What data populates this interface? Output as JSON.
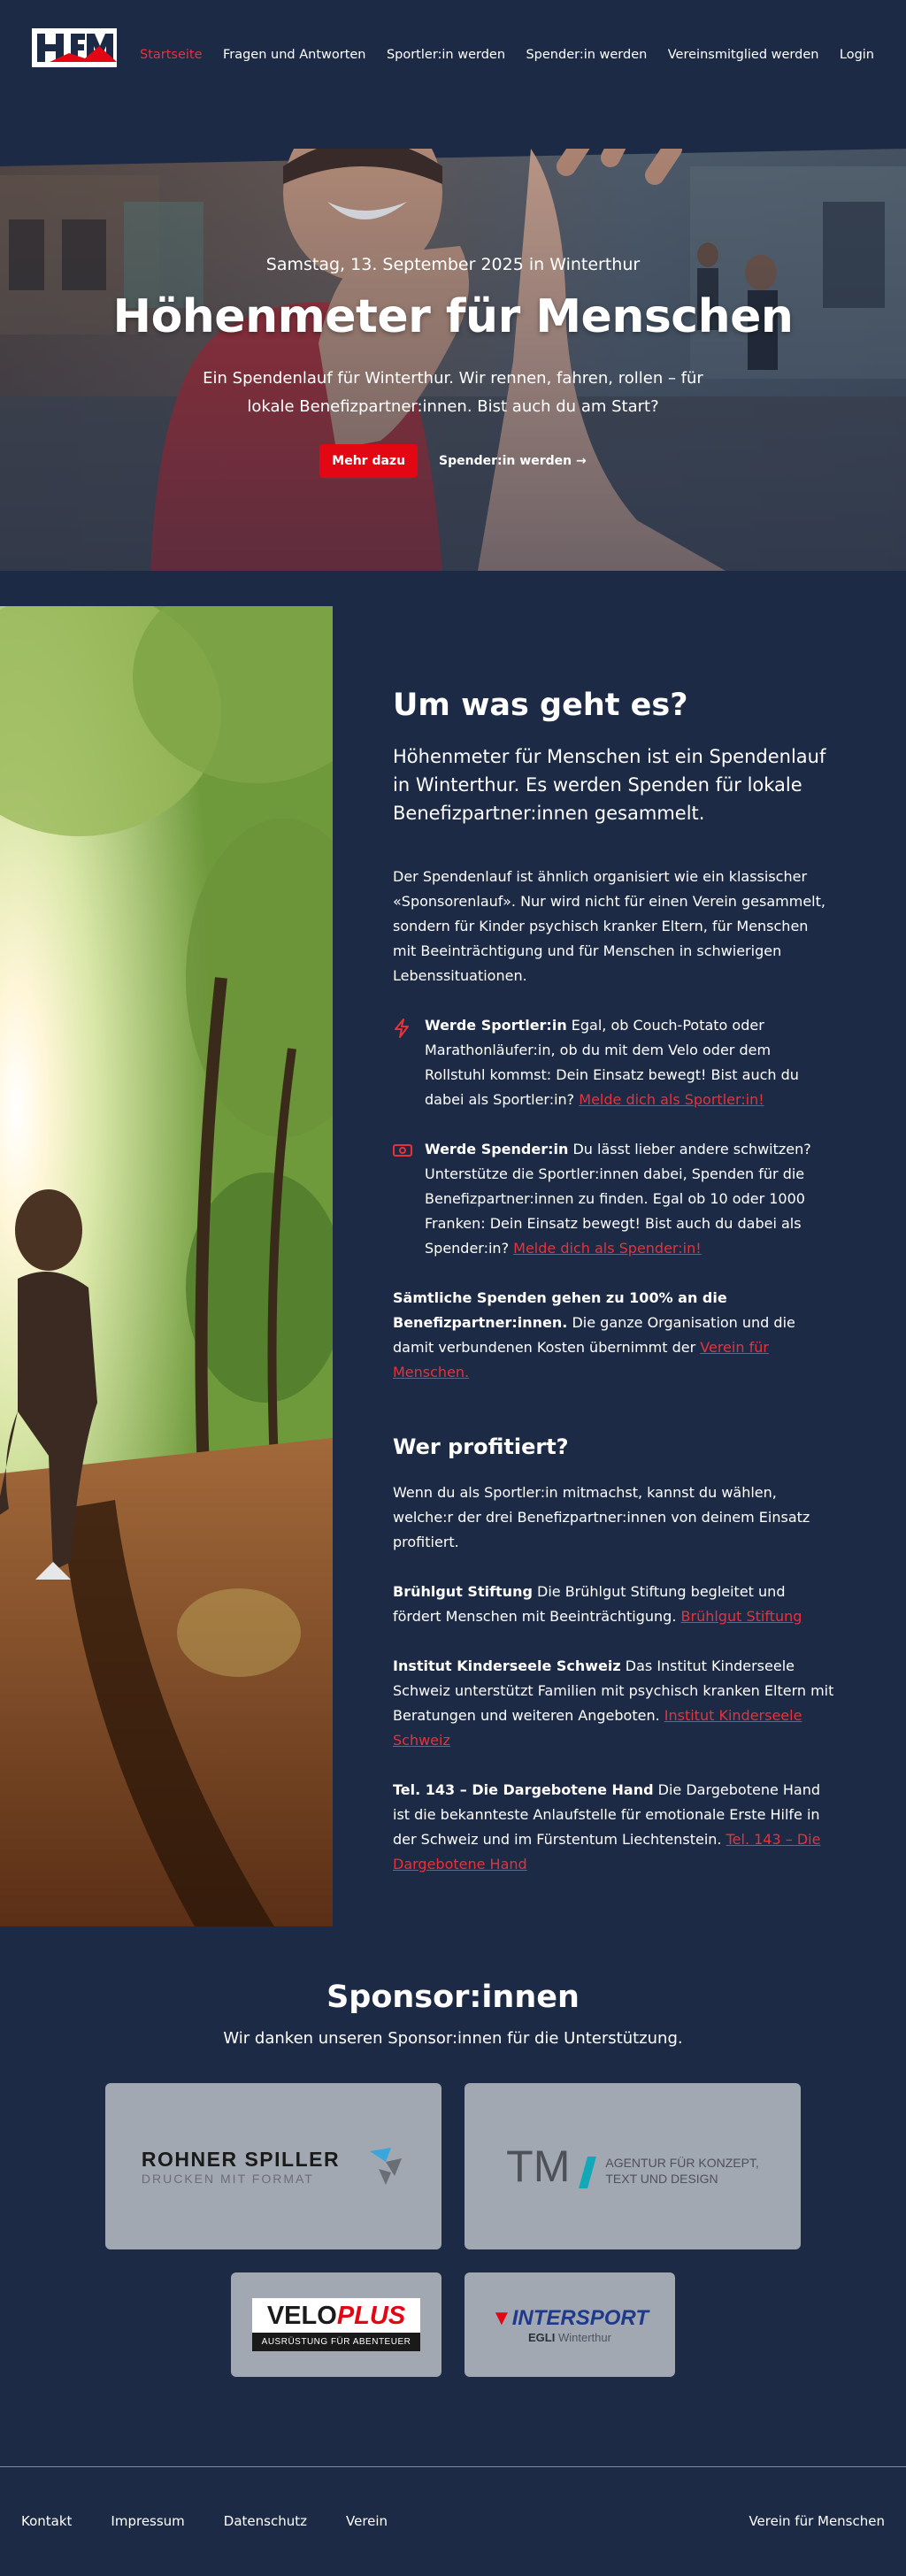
{
  "nav": {
    "items": [
      "Startseite",
      "Fragen und Antworten",
      "Sportler:in werden",
      "Spender:in werden",
      "Vereinsmitglied werden",
      "Login"
    ]
  },
  "hero": {
    "date": "Samstag, 13. September 2025 in Winterthur",
    "title": "Höhenmeter für Menschen",
    "text": "Ein Spendenlauf für Winterthur. Wir rennen, fahren, rollen – für lokale Benefizpartner:innen. Bist auch du am Start?",
    "primary_button": "Mehr dazu",
    "secondary_button": "Spender:in werden →"
  },
  "about": {
    "title": "Um was geht es?",
    "lead": "Höhenmeter für Menschen ist ein Spendenlauf in Winterthur. Es werden Spenden für lokale Benefizpartner:innen gesammelt.",
    "text": "Der Spendenlauf ist ähnlich organisiert wie ein klassischer «Sponsorenlauf». Nur wird nicht für einen Verein gesammelt, sondern für Kinder psychisch kranker Eltern, für Menschen mit Beeinträchtigung und für Menschen in schwierigen Lebenssituationen.",
    "features": [
      {
        "icon": "bolt-icon",
        "bold": "Werde Sportler:in",
        "text": " Egal, ob Couch-Potato oder Marathonläufer:in, ob du mit dem Velo oder dem Rollstuhl kommst: Dein Einsatz bewegt! Bist auch du dabei als Sportler:in? ",
        "link": "Melde dich als Sportler:in!"
      },
      {
        "icon": "banknote-icon",
        "bold": "Werde Spender:in",
        "text": " Du lässt lieber andere schwitzen? Unterstütze die Sportler:innen dabei, Spenden für die Benefizpartner:innen zu finden. Egal ob 10 oder 1000 Franken: Dein Einsatz bewegt! Bist auch du dabei als Spender:in? ",
        "link": "Melde dich als Spender:in!"
      }
    ],
    "donation_bold": "Sämtliche Spenden gehen zu 100% an die Benefizpartner:innen.",
    "donation_text": " Die ganze Organisation und die damit verbundenen Kosten übernimmt der ",
    "donation_link": "Verein für Menschen."
  },
  "beneficiaries": {
    "title": "Wer profitiert?",
    "intro": "Wenn du als Sportler:in mitmachst, kannst du wählen, welche:r der drei Benefizpartner:innen von deinem Einsatz profitiert.",
    "items": [
      {
        "name": "Brühlgut Stiftung",
        "text": " Die Brühlgut Stiftung begleitet und fördert Menschen mit Beeinträchtigung. ",
        "link": "Brühlgut Stiftung"
      },
      {
        "name": "Institut Kinderseele Schweiz",
        "text": " Das Institut Kinderseele Schweiz unterstützt Familien mit psychisch kranken Eltern mit Beratungen und weiteren Angeboten. ",
        "link": "Institut Kinderseele Schweiz"
      },
      {
        "name": "Tel. 143 – Die Dargebotene Hand",
        "text": " Die Dargebotene Hand ist die bekannteste Anlaufstelle für emotionale Erste Hilfe in der Schweiz und im Fürstentum Liechtenstein. ",
        "link": "Tel. 143 – Die Dargebotene Hand"
      }
    ]
  },
  "sponsors": {
    "title": "Sponsor:innen",
    "subtitle": "Wir danken unseren Sponsor:innen für die Unterstützung.",
    "rohner": {
      "name": "ROHNER SPILLER",
      "tagline": "DRUCKEN MIT FORMAT"
    },
    "tm": {
      "mark": "TM",
      "line1": "AGENTUR FÜR KONZEPT,",
      "line2": "TEXT UND DESIGN"
    },
    "velo": {
      "velo": "VELO",
      "plus": "PLUS",
      "tagline": "AUSRÜSTUNG FÜR ABENTEUER"
    },
    "intersport": {
      "name": "INTERSPORT",
      "sub1": "EGLI",
      "sub2": "Winterthur"
    }
  },
  "footer": {
    "links": [
      "Kontakt",
      "Impressum",
      "Datenschutz",
      "Verein"
    ],
    "right": "Verein für Menschen"
  },
  "colors": {
    "background": "#1c2a45",
    "accent": "#e8323a",
    "button": "#e30613",
    "sponsor_card": "#a2a8b1"
  }
}
